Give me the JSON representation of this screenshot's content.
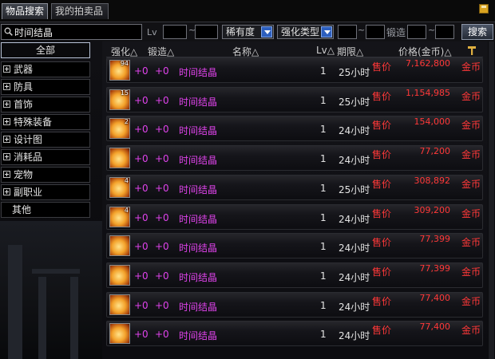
{
  "tabs": [
    "物品搜索",
    "我的拍卖品"
  ],
  "search": {
    "value": "时间结晶",
    "lv_label": "Lv",
    "tilde": "~",
    "rarity": "稀有度",
    "enhance_type": "强化类型",
    "forge_label": "锻造",
    "button": "搜索"
  },
  "categories": [
    {
      "label": "全部"
    },
    {
      "label": "武器"
    },
    {
      "label": "防具"
    },
    {
      "label": "首饰"
    },
    {
      "label": "特殊装备"
    },
    {
      "label": "设计图"
    },
    {
      "label": "消耗品"
    },
    {
      "label": "宠物"
    },
    {
      "label": "副职业"
    },
    {
      "label": "其他"
    }
  ],
  "columns": {
    "enhance": "强化△",
    "forge": "锻造△",
    "name": "名称△",
    "lv": "Lv△",
    "expire": "期限△",
    "price": "价格(金币)△"
  },
  "rows": [
    {
      "count": "94",
      "enhance": "+0",
      "forge": "+0",
      "name": "时间结晶",
      "lv": "1",
      "expire": "25小时",
      "sale": "售价",
      "price": "7,162,800",
      "currency": "金币"
    },
    {
      "count": "15",
      "enhance": "+0",
      "forge": "+0",
      "name": "时间结晶",
      "lv": "1",
      "expire": "25小时",
      "sale": "售价",
      "price": "1,154,985",
      "currency": "金币"
    },
    {
      "count": "2",
      "enhance": "+0",
      "forge": "+0",
      "name": "时间结晶",
      "lv": "1",
      "expire": "24小时",
      "sale": "售价",
      "price": "154,000",
      "currency": "金币"
    },
    {
      "count": "",
      "enhance": "+0",
      "forge": "+0",
      "name": "时间结晶",
      "lv": "1",
      "expire": "24小时",
      "sale": "售价",
      "price": "77,200",
      "currency": "金币"
    },
    {
      "count": "4",
      "enhance": "+0",
      "forge": "+0",
      "name": "时间结晶",
      "lv": "1",
      "expire": "25小时",
      "sale": "售价",
      "price": "308,892",
      "currency": "金币"
    },
    {
      "count": "4",
      "enhance": "+0",
      "forge": "+0",
      "name": "时间结晶",
      "lv": "1",
      "expire": "24小时",
      "sale": "售价",
      "price": "309,200",
      "currency": "金币"
    },
    {
      "count": "",
      "enhance": "+0",
      "forge": "+0",
      "name": "时间结晶",
      "lv": "1",
      "expire": "24小时",
      "sale": "售价",
      "price": "77,399",
      "currency": "金币"
    },
    {
      "count": "",
      "enhance": "+0",
      "forge": "+0",
      "name": "时间结晶",
      "lv": "1",
      "expire": "24小时",
      "sale": "售价",
      "price": "77,399",
      "currency": "金币"
    },
    {
      "count": "",
      "enhance": "+0",
      "forge": "+0",
      "name": "时间结晶",
      "lv": "1",
      "expire": "24小时",
      "sale": "售价",
      "price": "77,400",
      "currency": "金币"
    },
    {
      "count": "",
      "enhance": "+0",
      "forge": "+0",
      "name": "时间结晶",
      "lv": "1",
      "expire": "24小时",
      "sale": "售价",
      "price": "77,400",
      "currency": "金币"
    }
  ],
  "icons": {
    "save": "disk-icon",
    "search": "search-icon",
    "sort": "hammer-icon",
    "item": "time-crystal-icon"
  },
  "colors": {
    "item_name": "#e043ec",
    "sale": "#ff3838",
    "accent_button": "#2d5fbe"
  }
}
